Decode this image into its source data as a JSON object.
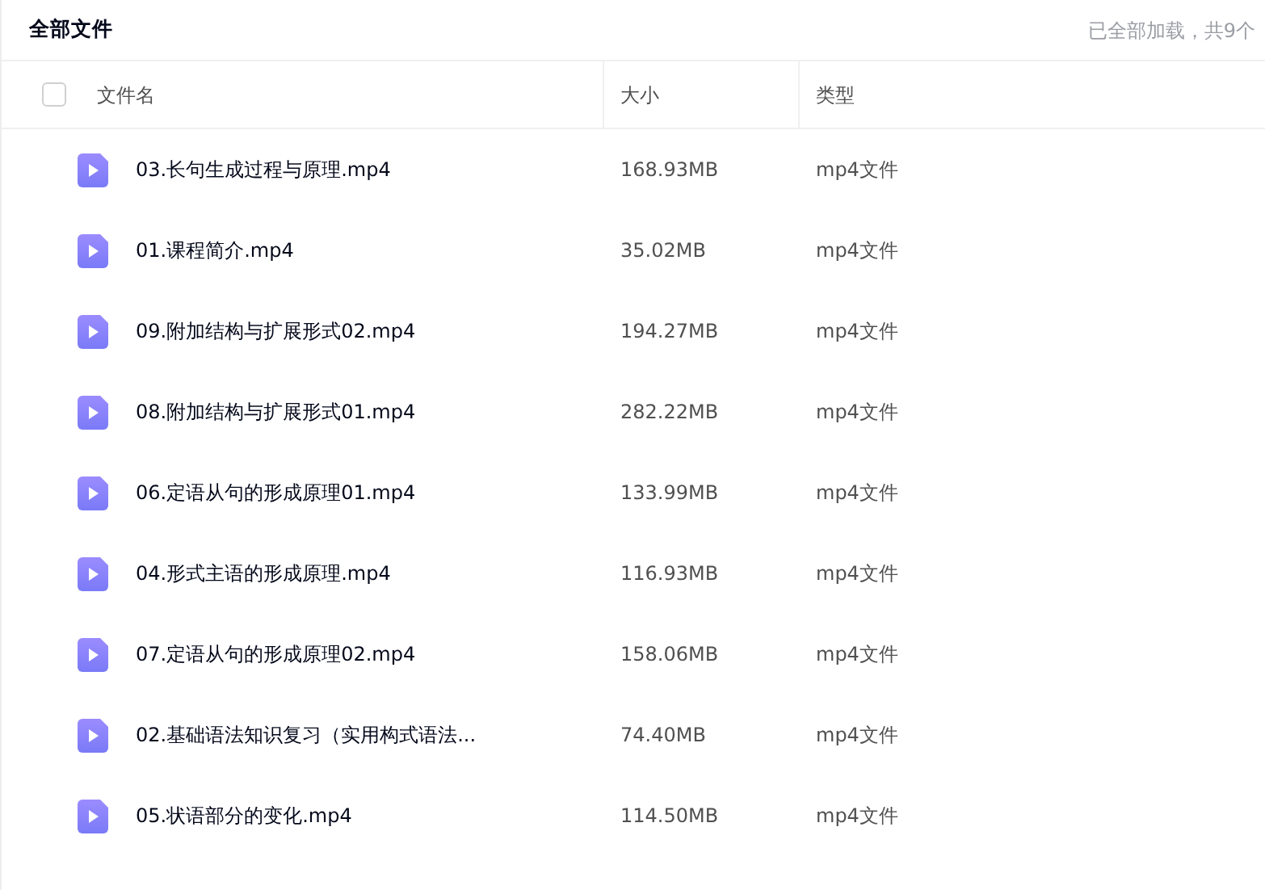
{
  "title": "全部文件",
  "load_status": "已全部加载，共9个",
  "select_all": {
    "checked": false
  },
  "columns": [
    "文件名",
    "大小",
    "类型"
  ],
  "files": [
    {
      "name": "03.长句生成过程与原理.mp4",
      "size": "168.93MB",
      "type": "mp4文件"
    },
    {
      "name": "01.课程简介.mp4",
      "size": "35.02MB",
      "type": "mp4文件"
    },
    {
      "name": "09.附加结构与扩展形式02.mp4",
      "size": "194.27MB",
      "type": "mp4文件"
    },
    {
      "name": "08.附加结构与扩展形式01.mp4",
      "size": "282.22MB",
      "type": "mp4文件"
    },
    {
      "name": "06.定语从句的形成原理01.mp4",
      "size": "133.99MB",
      "type": "mp4文件"
    },
    {
      "name": "04.形式主语的形成原理.mp4",
      "size": "116.93MB",
      "type": "mp4文件"
    },
    {
      "name": "07.定语从句的形成原理02.mp4",
      "size": "158.06MB",
      "type": "mp4文件"
    },
    {
      "name": "02.基础语法知识复习（实用构式语法...",
      "size": "74.40MB",
      "type": "mp4文件"
    },
    {
      "name": "05.状语部分的变化.mp4",
      "size": "114.50MB",
      "type": "mp4文件"
    }
  ]
}
